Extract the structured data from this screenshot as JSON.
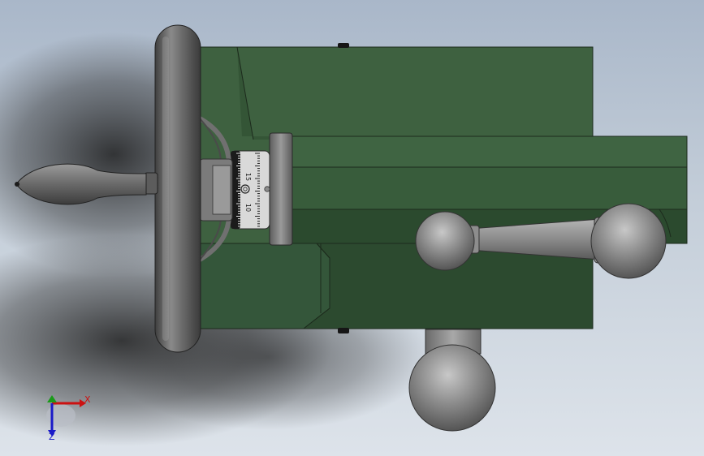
{
  "colors": {
    "background_top": "#a9b7c9",
    "background_bottom": "#dde3ea",
    "body_green": "#3d5f3c",
    "body_green_dark": "#28412a",
    "steel": "#8c8c8c",
    "steel_dark": "#4e4e4e",
    "axis_x": "#cc1111",
    "axis_y": "#1a9a1a",
    "axis_z": "#1a1ac8"
  },
  "dial": {
    "label_upper": "15",
    "label_lower": "10"
  },
  "triad": {
    "x_label": "X",
    "z_label": "Z"
  },
  "icons": [
    "axis-triad-icon",
    "handwheel-icon",
    "ball-handle-icon",
    "graduated-dial-icon"
  ]
}
